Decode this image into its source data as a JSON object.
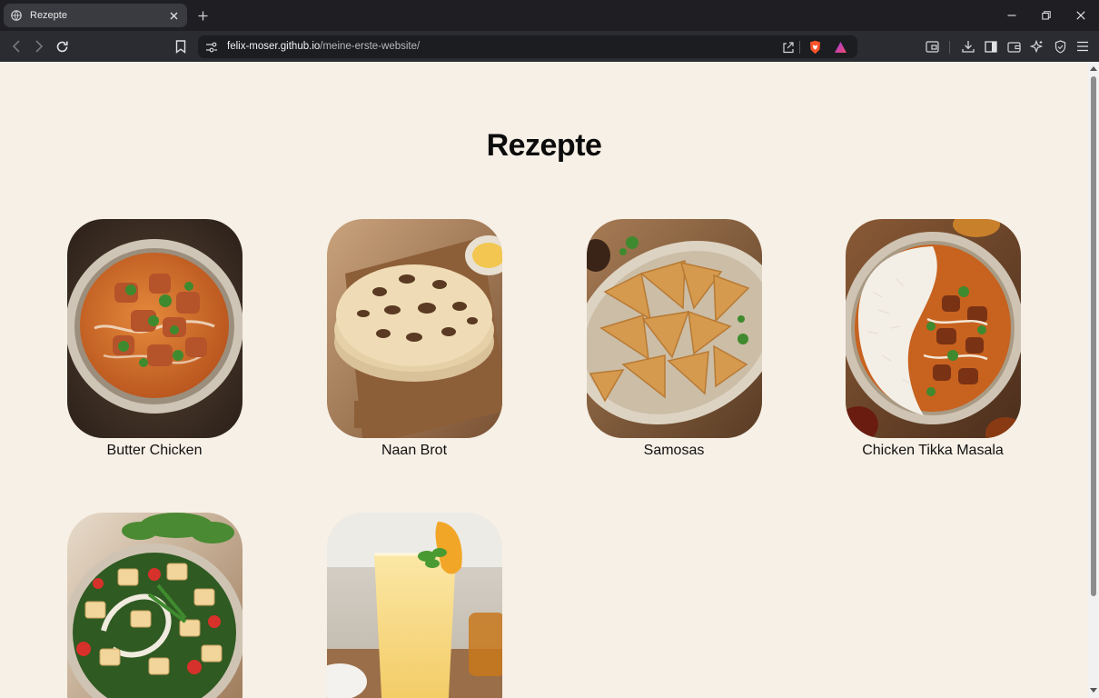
{
  "browser": {
    "tab": {
      "title": "Rezepte"
    },
    "address": {
      "host": "felix-moser.github.io",
      "path": "/meine-erste-website/"
    }
  },
  "page": {
    "title": "Rezepte",
    "recipes": [
      {
        "name": "Butter Chicken",
        "image": "butter-chicken-photo"
      },
      {
        "name": "Naan Brot",
        "image": "naan-brot-photo"
      },
      {
        "name": "Samosas",
        "image": "samosas-photo"
      },
      {
        "name": "Chicken Tikka Masala",
        "image": "chicken-tikka-masala-photo"
      },
      {
        "name": "",
        "image": "palak-paneer-photo"
      },
      {
        "name": "",
        "image": "mango-lassi-photo"
      }
    ]
  },
  "colors": {
    "page_background": "#f7f0e6",
    "tabbar": "#1f1f23",
    "toolbar": "#2b2c31",
    "brave_orange": "#fb542b"
  }
}
